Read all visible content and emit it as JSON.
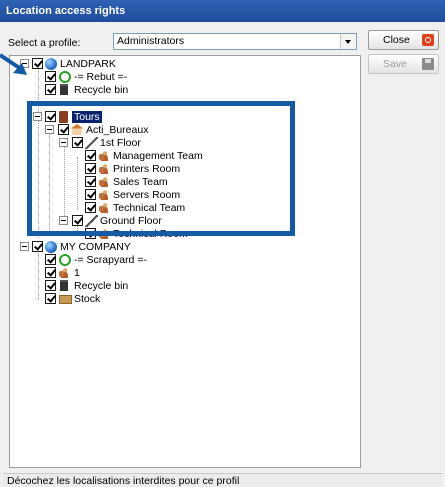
{
  "window": {
    "title": "Location access rights"
  },
  "profile": {
    "label": "Select a profile:",
    "value": "Administrators"
  },
  "buttons": {
    "close": "Close",
    "save": "Save"
  },
  "status_text": "Décochez les localisations interdites pour ce profil",
  "tree": {
    "landpark": "LANDPARK",
    "rebut": "-= Rebut =-",
    "recycle_bin": "Recycle bin",
    "tours": "Tours",
    "acti_bureaux": "Acti_Bureaux",
    "first_floor": "1st Floor",
    "management_team": "Management Team",
    "printers_room": "Printers Room",
    "sales_team": "Sales Team",
    "servers_room": "Servers Room",
    "technical_team": "Technical Team",
    "ground_floor": "Ground Floor",
    "technical_room": "Technical Room",
    "my_company": "MY COMPANY",
    "scrapyard": "-= Scrapyard =-",
    "one": "1",
    "recycle_bin_2": "Recycle bin",
    "stock": "Stock"
  },
  "colors": {
    "title_bar": "#1f4d9c",
    "highlight": "#145ba6",
    "selection": "#0a246a"
  }
}
